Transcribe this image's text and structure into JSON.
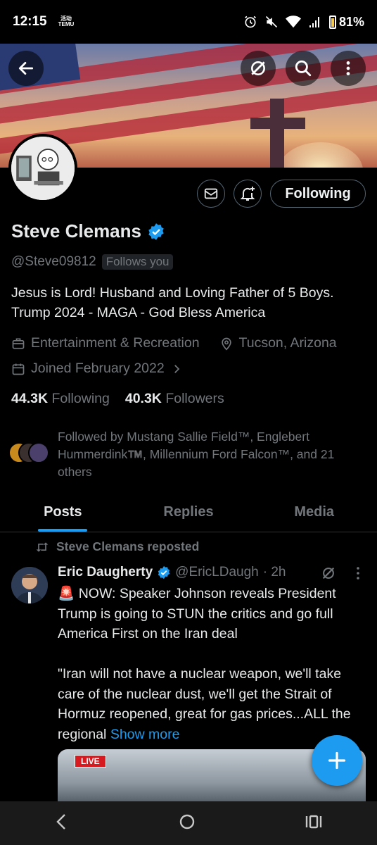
{
  "status_bar": {
    "time": "12:15",
    "temu_top": "活动",
    "temu_bottom": "TEMU",
    "battery": "81%"
  },
  "profile": {
    "name": "Steve Clemans",
    "handle": "@Steve09812",
    "follows_you": "Follows you",
    "bio_line1": "Jesus is Lord!  Husband and Loving Father of 5 Boys.",
    "bio_line2": "Trump 2024 - MAGA - God Bless America",
    "category": "Entertainment & Recreation",
    "location": "Tucson, Arizona",
    "joined": "Joined February 2022",
    "following_count": "44.3K",
    "following_label": "Following",
    "followers_count": "40.3K",
    "followers_label": "Followers",
    "followed_by": "Followed by Mustang Sallie Field™, Englebert Hummerdink™️, Millennium Ford Falcon™, and 21 others",
    "follow_button": "Following"
  },
  "tabs": [
    {
      "label": "Posts",
      "active": true
    },
    {
      "label": "Replies",
      "active": false
    },
    {
      "label": "Media",
      "active": false
    }
  ],
  "tweet": {
    "repost_label": "Steve Clemans reposted",
    "author_name": "Eric Daugherty",
    "author_handle": "@EricLDaugh",
    "time": "· 2h",
    "line1": "🚨 NOW: Speaker Johnson reveals President Trump is going to STUN the critics and go full America First on the Iran deal",
    "line2": "\"Iran will not have a nuclear weapon, we'll take care of the nuclear dust, we'll get the Strait of Hormuz reopened, great for gas prices...ALL the regional",
    "show_more": "Show more",
    "media_badge": "LIVE"
  },
  "colors": {
    "accent": "#1d9bf0",
    "muted": "#71767b",
    "text": "#e7e9ea",
    "background": "#000000"
  }
}
